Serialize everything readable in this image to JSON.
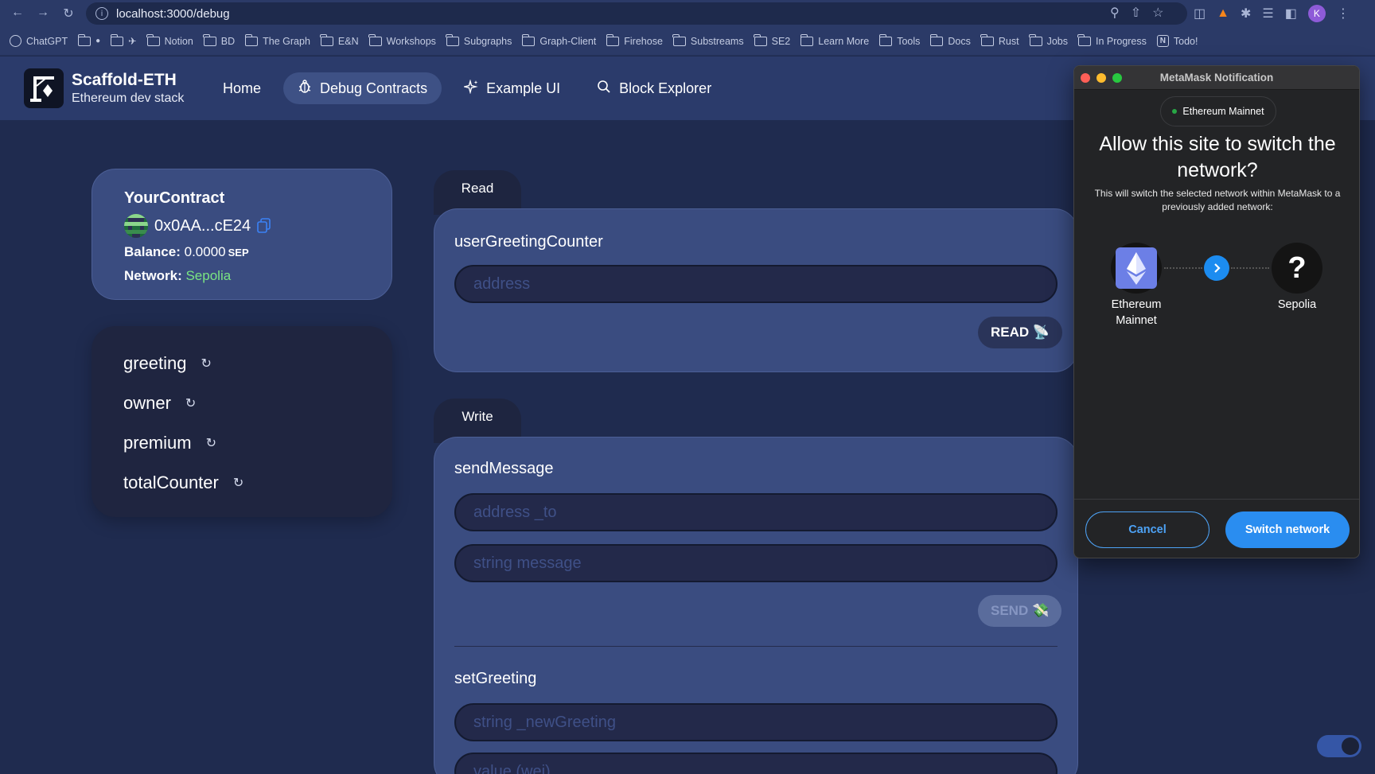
{
  "browser": {
    "url": "localhost:3000/debug",
    "profile_initial": "K",
    "bookmarks": [
      "ChatGPT",
      "",
      "",
      "Notion",
      "BD",
      "The Graph",
      "E&N",
      "Workshops",
      "Subgraphs",
      "Graph-Client",
      "Firehose",
      "Substreams",
      "SE2",
      "Learn More",
      "Tools",
      "Docs",
      "Rust",
      "Jobs",
      "In Progress",
      "Todo!"
    ]
  },
  "header": {
    "brand_title": "Scaffold-ETH",
    "brand_subtitle": "Ethereum dev stack",
    "nav": [
      {
        "label": "Home",
        "icon": "none",
        "active": false
      },
      {
        "label": "Debug Contracts",
        "icon": "bug-icon",
        "active": true
      },
      {
        "label": "Example UI",
        "icon": "sparkles-icon",
        "active": false
      },
      {
        "label": "Block Explorer",
        "icon": "search-icon",
        "active": false
      }
    ]
  },
  "contract": {
    "name": "YourContract",
    "address": "0x0AA...cE24",
    "balance_label": "Balance:",
    "balance_value": "0.0000",
    "balance_unit": "SEP",
    "network_label": "Network:",
    "network_value": "Sepolia"
  },
  "variables": [
    "greeting",
    "owner",
    "premium",
    "totalCounter"
  ],
  "read": {
    "tab": "Read",
    "function_name": "userGreetingCounter",
    "input_placeholder": "address",
    "button_label": "READ 📡"
  },
  "write": {
    "tab": "Write",
    "send_message": {
      "name": "sendMessage",
      "placeholders": [
        "address _to",
        "string message"
      ],
      "button_label": "SEND 💸"
    },
    "set_greeting": {
      "name": "setGreeting",
      "placeholders": [
        "string _newGreeting",
        "value (wei)"
      ]
    }
  },
  "metamask": {
    "window_title": "MetaMask Notification",
    "current_network": "Ethereum Mainnet",
    "heading": "Allow this site to switch the network?",
    "description": "This will switch the selected network within MetaMask to a previously added network:",
    "from_network_line1": "Ethereum",
    "from_network_line2": "Mainnet",
    "to_network": "Sepolia",
    "to_network_glyph": "?",
    "cancel_label": "Cancel",
    "switch_label": "Switch network"
  },
  "colors": {
    "page_bg": "#1f2b4f",
    "card_bg": "#3a4c80",
    "accent_green": "#7ae582",
    "metamask_blue": "#2a8df0"
  }
}
